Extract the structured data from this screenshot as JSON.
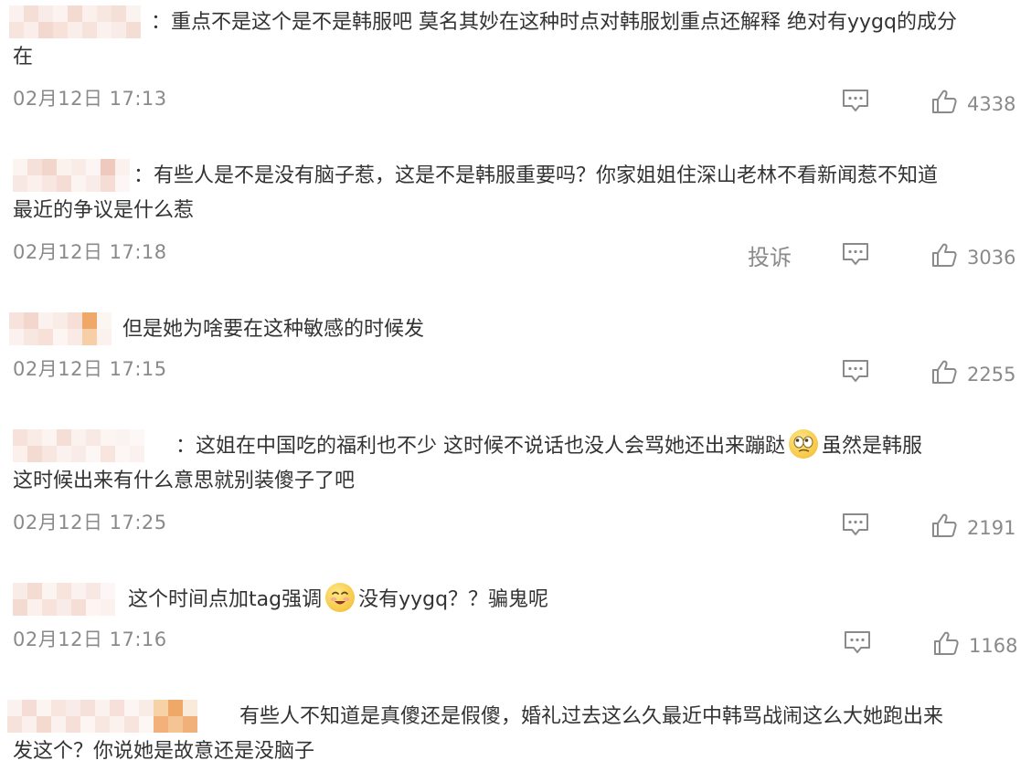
{
  "comments": [
    {
      "text_lines": [
        "：重点不是这个是不是韩服吧 莫名其妙在这种时点对韩服划重点还解释 绝对有yygq的成分",
        "在"
      ],
      "time": "02月12日 17:13",
      "likes": "4338"
    },
    {
      "text_lines": [
        "：有些人是不是没有脑子惹，这是不是韩服重要吗？你家姐姐住深山老林不看新闻惹不知道",
        "最近的争议是什么惹"
      ],
      "time": "02月12日 17:18",
      "report": "投诉",
      "likes": "3036"
    },
    {
      "text_lines": [
        "但是她为啥要在这种敏感的时候发"
      ],
      "time": "02月12日 17:15",
      "likes": "2255"
    },
    {
      "text_before_emoji": "：这姐在中国吃的福利也不少 这时候不说话也没人会骂她还出来蹦跶",
      "text_after_emoji": "虽然是韩服",
      "text_line2": "这时候出来有什么意思就别装傻子了吧",
      "time": "02月12日 17:25",
      "likes": "2191"
    },
    {
      "text_before_emoji": "这个时间点加tag强调",
      "text_after_emoji": "没有yygq？？骗鬼呢",
      "time": "02月12日 17:16",
      "likes": "1168"
    },
    {
      "text_lines": [
        "有些人不知道是真傻还是假傻，婚礼过去这么久最近中韩骂战闹这么大她跑出来",
        "发这个？你说她是故意还是没脑子"
      ]
    }
  ],
  "icons": {
    "comment": "comment-icon",
    "like": "thumbs-up-icon",
    "emoji_1": "sneer-emoji-icon",
    "emoji_2": "smile-emoji-icon"
  },
  "colors": {
    "text": "#333333",
    "meta": "#8a8a8a",
    "mosaic_peach": "#f6d9cf",
    "mosaic_orange": "#f2b585"
  }
}
